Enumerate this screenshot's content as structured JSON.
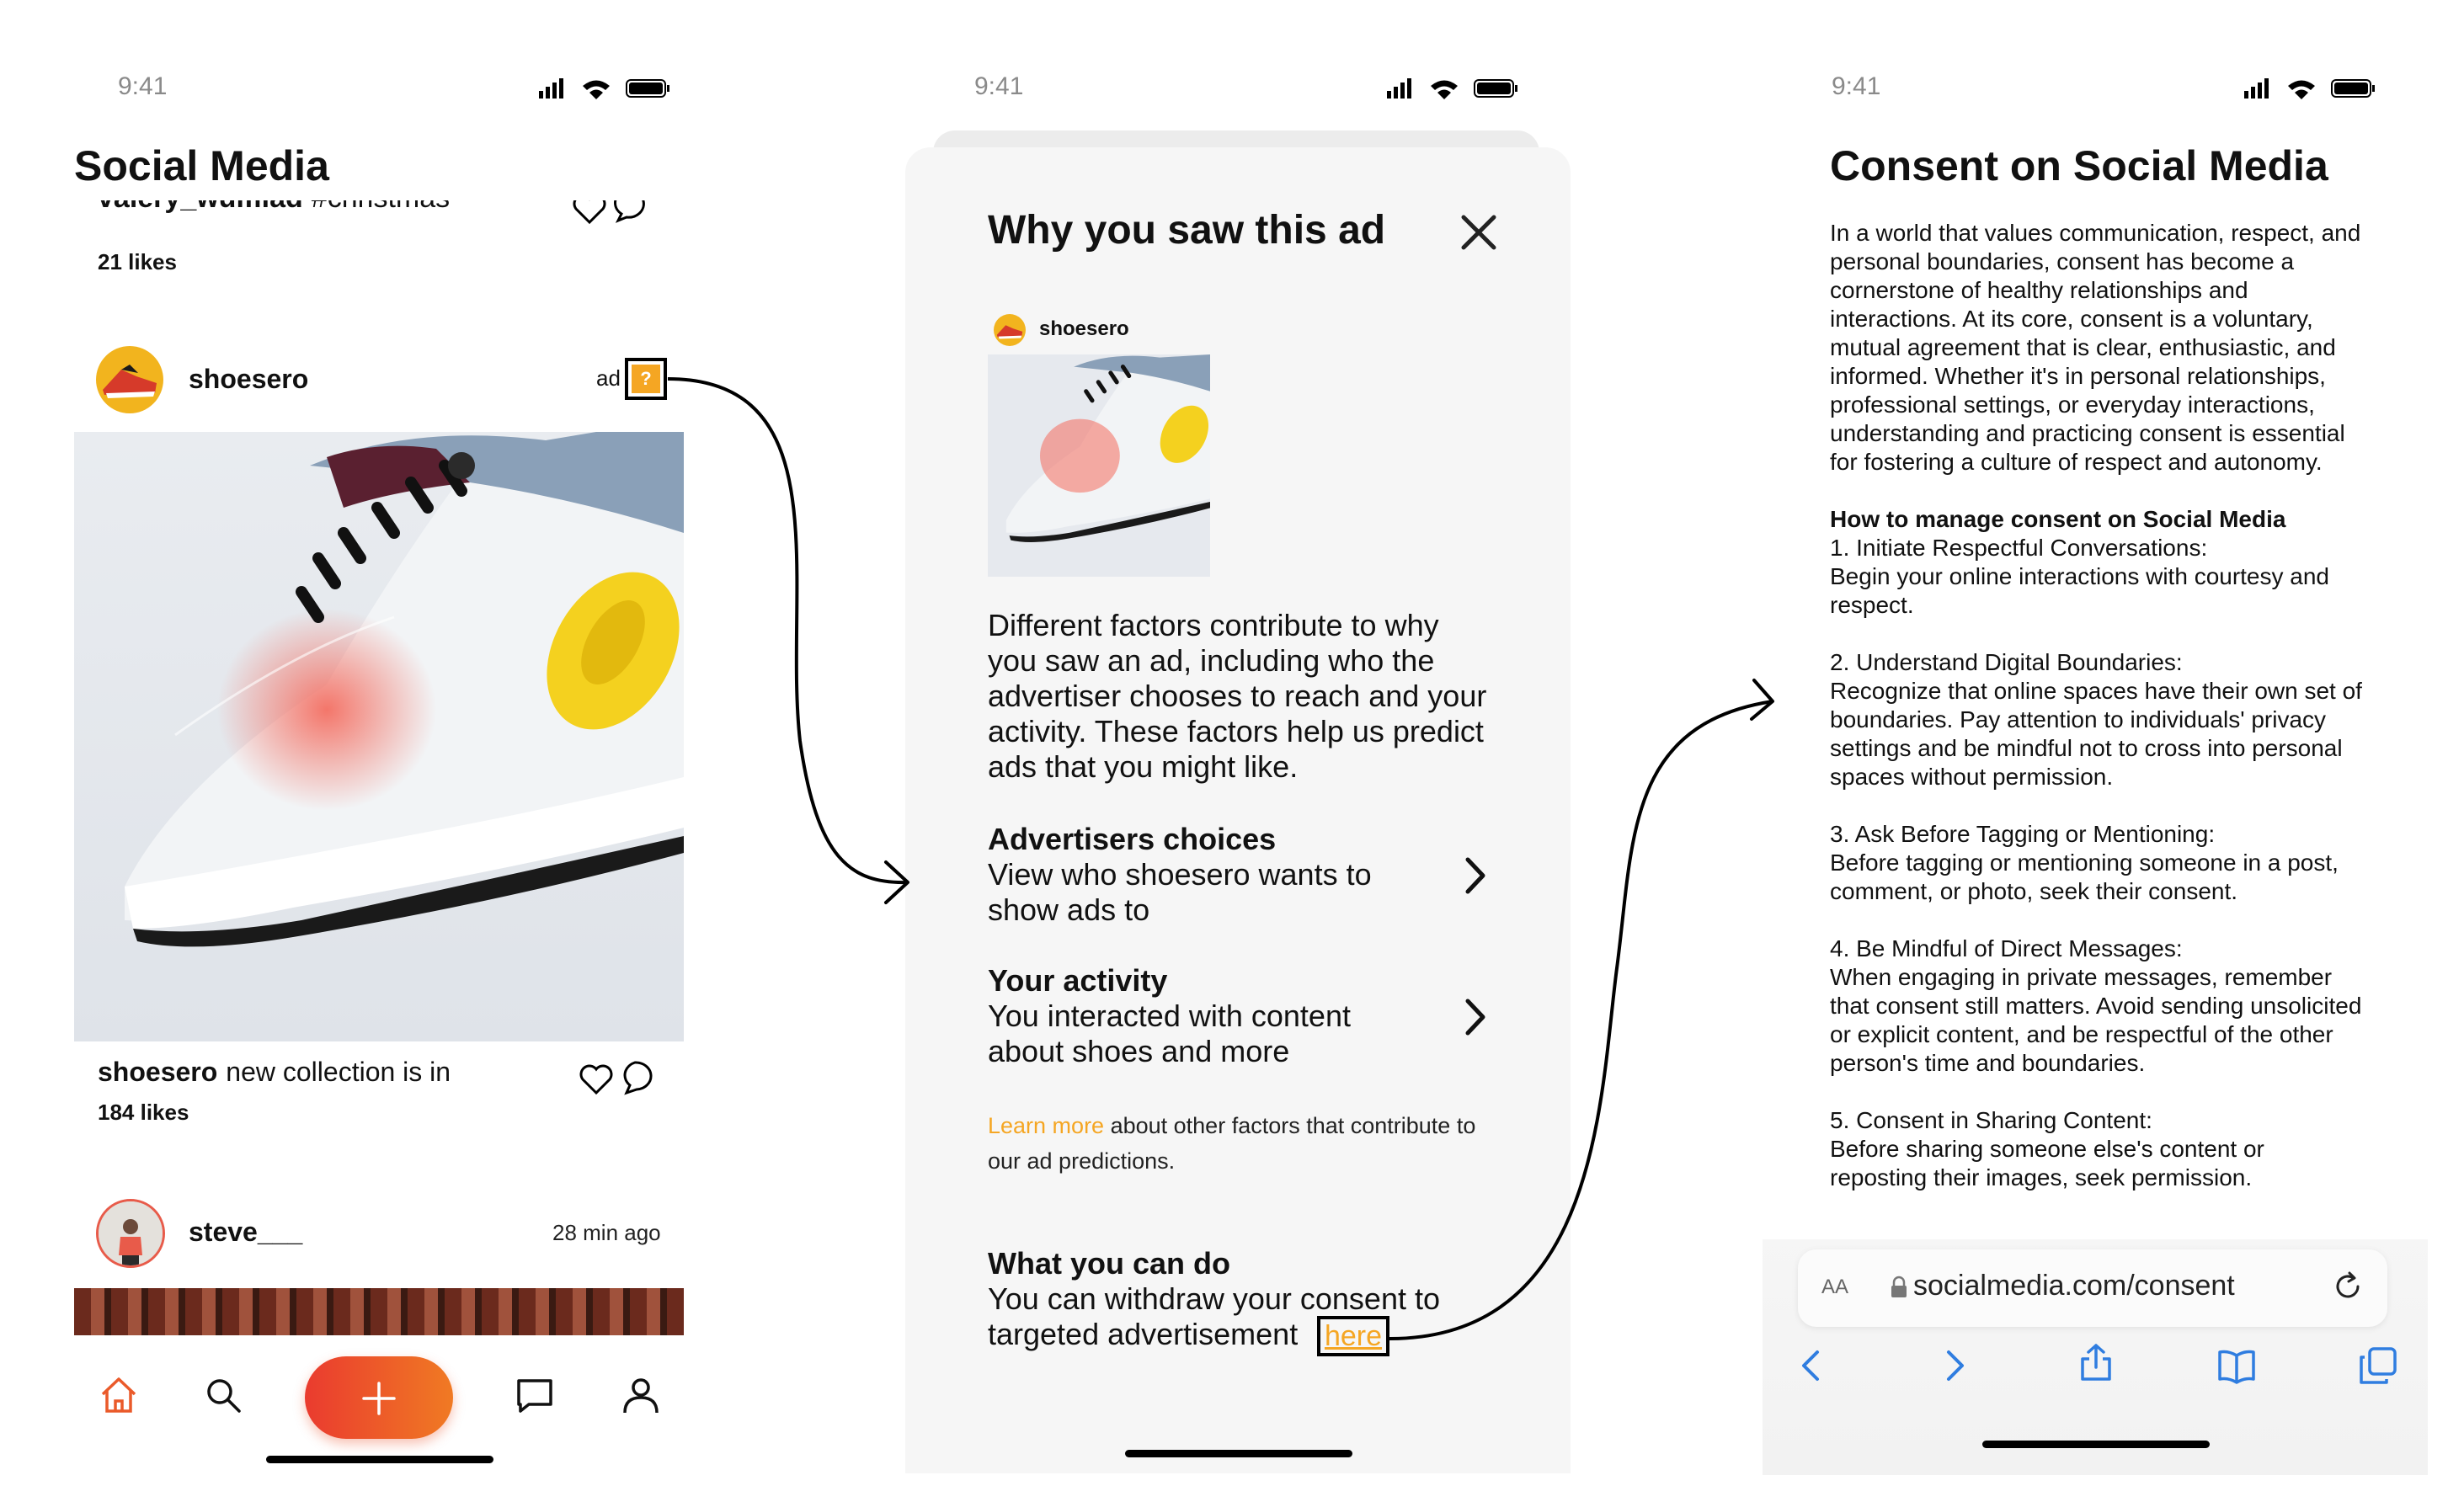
{
  "status_bar": {
    "time": "9:41"
  },
  "screen1": {
    "title": "Social Media",
    "prev_post": {
      "user": "valery_wulfliad",
      "tag": "#christmas",
      "likes": "21 likes"
    },
    "ad_post": {
      "user": "shoesero",
      "ad_label": "ad",
      "help_icon": "?",
      "caption_user": "shoesero",
      "caption_text": "new collection is in",
      "likes": "184 likes"
    },
    "next_post": {
      "user": "steve___",
      "time": "28 min ago"
    },
    "nav": {
      "icons": [
        "home-icon",
        "search-icon",
        "plus-icon",
        "chat-icon",
        "profile-icon"
      ]
    },
    "colors": {
      "accent": "#f5a623",
      "fab_start": "#ea3b2f",
      "fab_end": "#f07a23",
      "home_active": "#ea5a2a"
    }
  },
  "screen2": {
    "title": "Why you saw this ad",
    "advertiser": "shoesero",
    "intro": "Different factors contribute to why you saw an ad, including who the advertiser chooses to reach and your activity. These factors help us predict ads that you might like.",
    "sections": [
      {
        "heading": "Advertisers choices",
        "body": "View who shoesero wants to show ads to"
      },
      {
        "heading": "Your activity",
        "body": "You interacted with content about shoes and more"
      }
    ],
    "learn_more": {
      "link": "Learn more",
      "text": " about other factors that contribute to our ad predictions."
    },
    "what_you_can_do": {
      "heading": "What you can do",
      "body": "You can withdraw your consent to targeted advertisement",
      "link": "here"
    }
  },
  "screen3": {
    "title": "Consent on Social Media",
    "paragraphs": [
      "In a world that values communication, respect, and personal boundaries, consent has become a cornerstone of healthy relationships and interactions. At its core, consent is a voluntary, mutual agreement that is clear, enthusiastic, and informed. Whether it's in personal relationships, professional settings, or everyday interactions, understanding and practicing consent is essential for fostering a culture of respect and autonomy."
    ],
    "how_heading": "How to manage consent on Social Media",
    "items": [
      {
        "title": "1. Initiate Respectful Conversations:",
        "body": "Begin your online interactions with courtesy and respect."
      },
      {
        "title": "2. Understand Digital Boundaries:",
        "body": "Recognize that online spaces have their own set of boundaries. Pay attention to individuals' privacy settings and be mindful not to cross into personal spaces without permission."
      },
      {
        "title": "3. Ask Before Tagging or Mentioning:",
        "body": "Before tagging or mentioning someone in a post, comment, or photo, seek their consent."
      },
      {
        "title": "4. Be Mindful of Direct Messages:",
        "body": "When engaging in private messages, remember that consent still matters. Avoid sending unsolicited or explicit content, and be respectful of the other person's time and boundaries."
      },
      {
        "title": "5. Consent in Sharing Content:",
        "body": "Before sharing someone else's content or reposting their images, seek permission."
      }
    ],
    "browser": {
      "text_size": "AA",
      "url": "socialmedia.com/consent"
    }
  }
}
